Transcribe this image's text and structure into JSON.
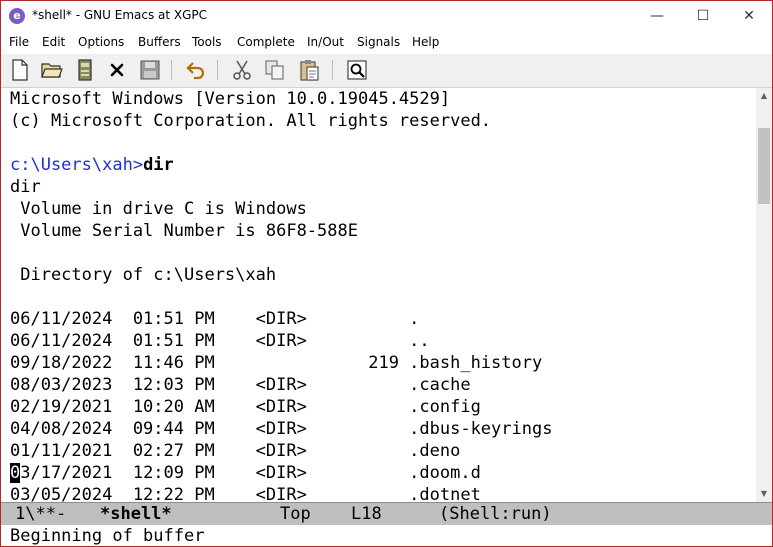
{
  "window": {
    "title": "*shell* - GNU Emacs at XGPC",
    "app_icon": "e",
    "minimize": "—",
    "maximize": "☐",
    "close": "✕"
  },
  "menu": [
    "File",
    "Edit",
    "Options",
    "Buffers",
    "Tools",
    "Complete",
    "In/Out",
    "Signals",
    "Help"
  ],
  "toolbar_icons": [
    "new-file-icon",
    "open-folder-icon",
    "save-icon",
    "close-buffer-icon",
    "save-as-icon",
    "undo-icon",
    "cut-icon",
    "copy-icon",
    "paste-icon",
    "search-icon"
  ],
  "buffer": {
    "header1": "Microsoft Windows [Version 10.0.19045.4529]",
    "header2": "(c) Microsoft Corporation. All rights reserved.",
    "prompt": "c:\\Users\\xah>",
    "command": "dir",
    "echo_cmd": "dir",
    "volume1": " Volume in drive C is Windows",
    "volume2": " Volume Serial Number is 86F8-588E",
    "directory": " Directory of c:\\Users\\xah",
    "rows": [
      "06/11/2024  01:51 PM    <DIR>          .",
      "06/11/2024  01:51 PM    <DIR>          ..",
      "09/18/2022  11:46 PM               219 .bash_history",
      "08/03/2023  12:03 PM    <DIR>          .cache",
      "02/19/2021  10:20 AM    <DIR>          .config",
      "04/08/2024  09:44 PM    <DIR>          .dbus-keyrings",
      "01/11/2021  02:27 PM    <DIR>          .deno",
      "03/17/2021  12:09 PM    <DIR>          .doom.d",
      "03/05/2024  12:22 PM    <DIR>          .dotnet"
    ],
    "cursor_row": {
      "cursor_char": "0",
      "rest": "3/17/2021  12:09 PM    <DIR>          .doom.d"
    }
  },
  "modeline": {
    "status": "1\\**-",
    "buffer_name": "*shell*",
    "position": "Top",
    "line": "L18",
    "mode": "(Shell:run)"
  },
  "echo": "Beginning of buffer",
  "colors": {
    "prompt": "#1f2fd6",
    "window_border": "#b0282c",
    "modeline_bg": "#bfbfbf"
  }
}
